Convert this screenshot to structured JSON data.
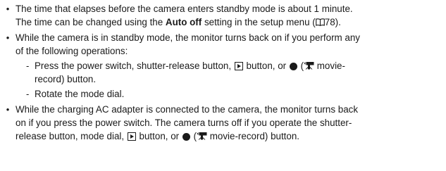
{
  "bullets": [
    {
      "lines": [
        {
          "text": "The time that elapses before the camera enters standby mode is about 1 minute."
        },
        {
          "pre": "The time can be changed using the ",
          "bold": "Auto off",
          "post": " setting in the setup menu (",
          "page_ref": "78",
          "end": ")."
        }
      ]
    },
    {
      "lines": [
        {
          "text": "While the camera is in standby mode, the monitor turns back on if you perform any"
        },
        {
          "text": "of the following operations:"
        }
      ],
      "sub_items": [
        {
          "dash": "-",
          "line1_pre": "Press the power switch, shutter-release button, ",
          "line1_mid": " button, or ",
          "line1_open": " (",
          "line1_post": " movie-",
          "line2": "record) button."
        },
        {
          "dash": "-",
          "text": "Rotate the mode dial."
        }
      ]
    },
    {
      "lines": [
        {
          "text": "While the charging AC adapter is connected to the camera, the monitor turns back"
        },
        {
          "text": "on if you press the power switch. The camera turns off if you operate the shutter-"
        },
        {
          "pre": "release button, mode dial, ",
          "mid": " button, or ",
          "open": " (",
          "post": " movie-record) button."
        }
      ]
    }
  ],
  "bullet_symbol": "•",
  "icons": [
    "play-button-icon",
    "movie-record-dot-icon",
    "movie-camera-icon",
    "page-reference-book-icon"
  ]
}
